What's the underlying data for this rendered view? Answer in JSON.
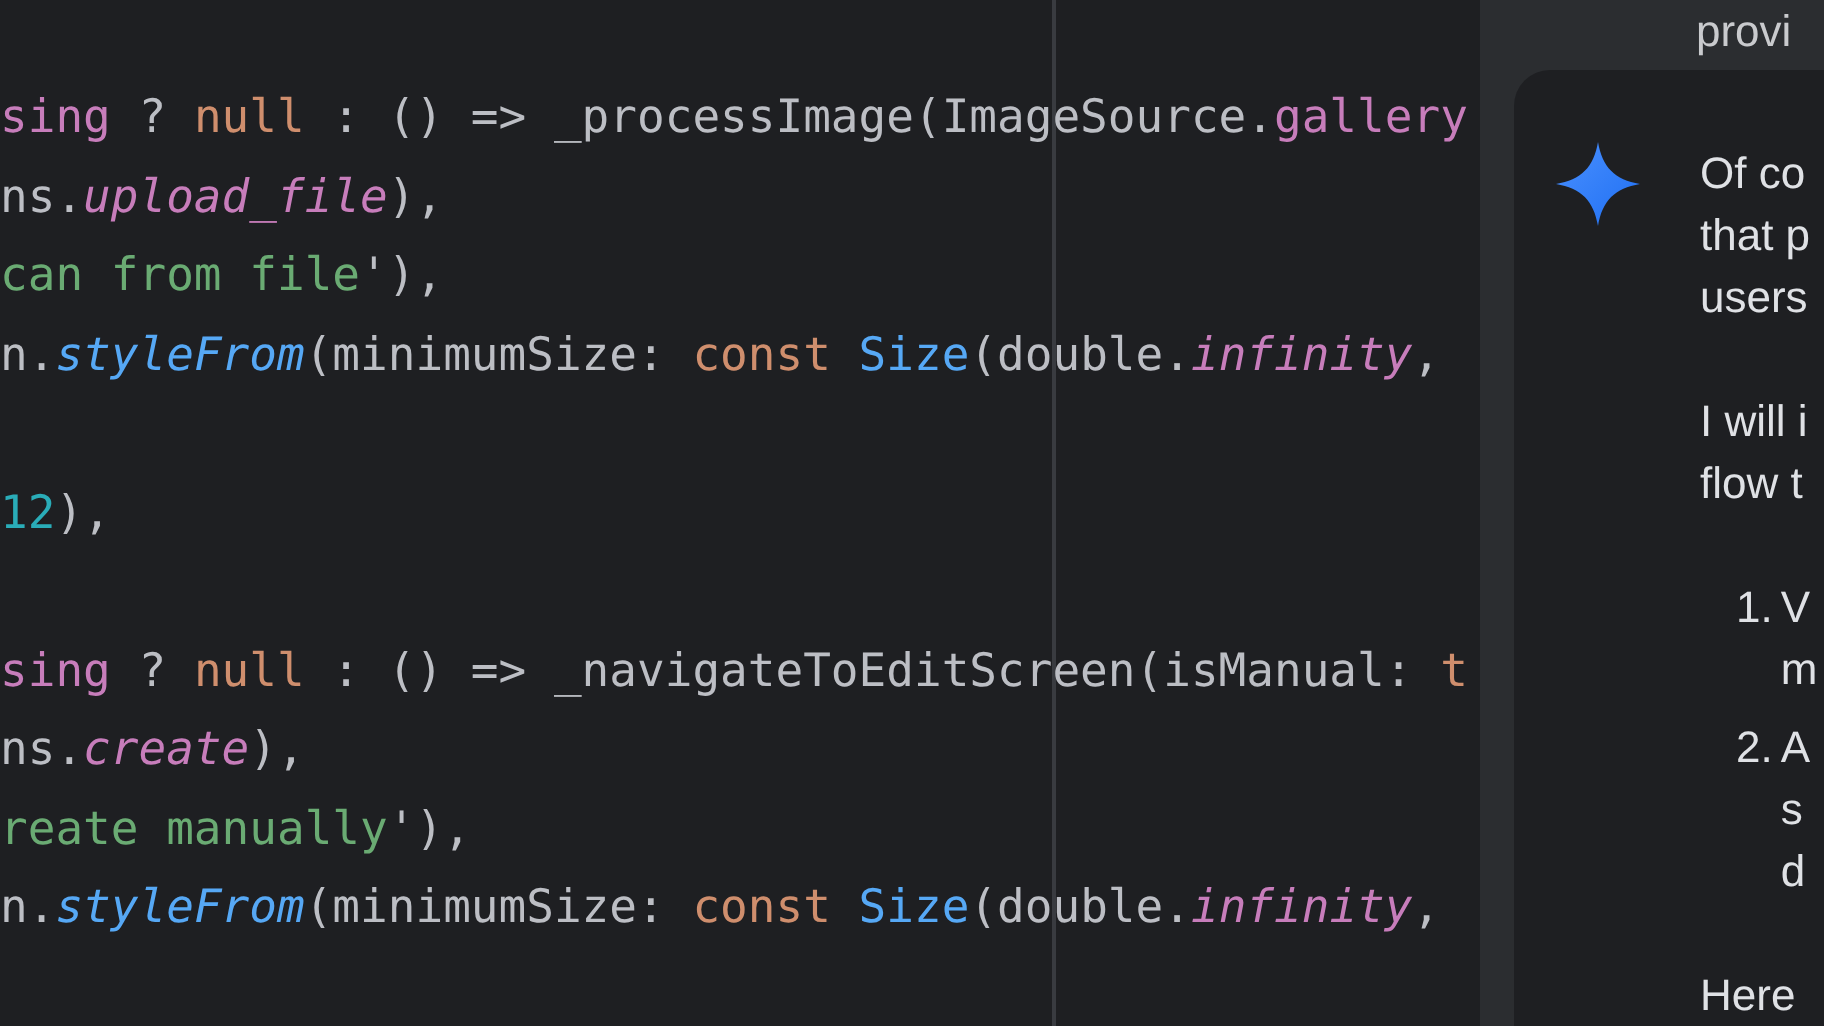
{
  "editor": {
    "code_blocks": [
      [
        {
          "tokens": [
            {
              "text": "sing",
              "kind": "property"
            },
            {
              "text": " ? ",
              "kind": "plain"
            },
            {
              "text": "null",
              "kind": "keyword"
            },
            {
              "text": " : () => _processImage(ImageSource.",
              "kind": "plain"
            },
            {
              "text": "gallery",
              "kind": "property"
            }
          ]
        },
        {
          "tokens": [
            {
              "text": "ns.",
              "kind": "plain"
            },
            {
              "text": "upload_file",
              "kind": "property_italic"
            },
            {
              "text": "),",
              "kind": "plain"
            }
          ]
        },
        {
          "tokens": [
            {
              "text": "can from file",
              "kind": "string"
            },
            {
              "text": "'),",
              "kind": "plain"
            }
          ]
        },
        {
          "tokens": [
            {
              "text": "n.",
              "kind": "plain"
            },
            {
              "text": "styleFrom",
              "kind": "method"
            },
            {
              "text": "(minimumSize: ",
              "kind": "plain"
            },
            {
              "text": "const ",
              "kind": "keyword"
            },
            {
              "text": "Size",
              "kind": "type"
            },
            {
              "text": "(double.",
              "kind": "plain"
            },
            {
              "text": "infinity",
              "kind": "property_italic"
            },
            {
              "text": ", ",
              "kind": "plain"
            }
          ]
        }
      ],
      [
        {
          "tokens": [
            {
              "text": "12",
              "kind": "number"
            },
            {
              "text": "),",
              "kind": "plain"
            }
          ]
        }
      ],
      [
        {
          "tokens": [
            {
              "text": "sing",
              "kind": "property"
            },
            {
              "text": " ? ",
              "kind": "plain"
            },
            {
              "text": "null",
              "kind": "keyword"
            },
            {
              "text": " : () => _navigateToEditScreen(isManual: ",
              "kind": "plain"
            },
            {
              "text": "t",
              "kind": "keyword"
            }
          ]
        },
        {
          "tokens": [
            {
              "text": "ns.",
              "kind": "plain"
            },
            {
              "text": "create",
              "kind": "property_italic"
            },
            {
              "text": "),",
              "kind": "plain"
            }
          ]
        },
        {
          "tokens": [
            {
              "text": "reate manually",
              "kind": "string"
            },
            {
              "text": "'),",
              "kind": "plain"
            }
          ]
        },
        {
          "tokens": [
            {
              "text": "n.",
              "kind": "plain"
            },
            {
              "text": "styleFrom",
              "kind": "method"
            },
            {
              "text": "(minimumSize: ",
              "kind": "plain"
            },
            {
              "text": "const ",
              "kind": "keyword"
            },
            {
              "text": "Size",
              "kind": "type"
            },
            {
              "text": "(double.",
              "kind": "plain"
            },
            {
              "text": "infinity",
              "kind": "property_italic"
            },
            {
              "text": ", ",
              "kind": "plain"
            }
          ]
        }
      ]
    ]
  },
  "chat": {
    "previous_text": "provi",
    "message": {
      "blocks": [
        {
          "kind": "paragraph",
          "lines": [
            "Of co",
            "that p",
            "users"
          ]
        },
        {
          "kind": "paragraph",
          "lines": [
            "I will i",
            "flow t"
          ]
        },
        {
          "kind": "list",
          "items": [
            {
              "marker": "1.",
              "lines": [
                "V",
                "m"
              ]
            },
            {
              "marker": "2.",
              "lines": [
                "A",
                "s",
                "d"
              ]
            }
          ]
        },
        {
          "kind": "paragraph",
          "lines": [
            "Here"
          ]
        }
      ]
    }
  }
}
